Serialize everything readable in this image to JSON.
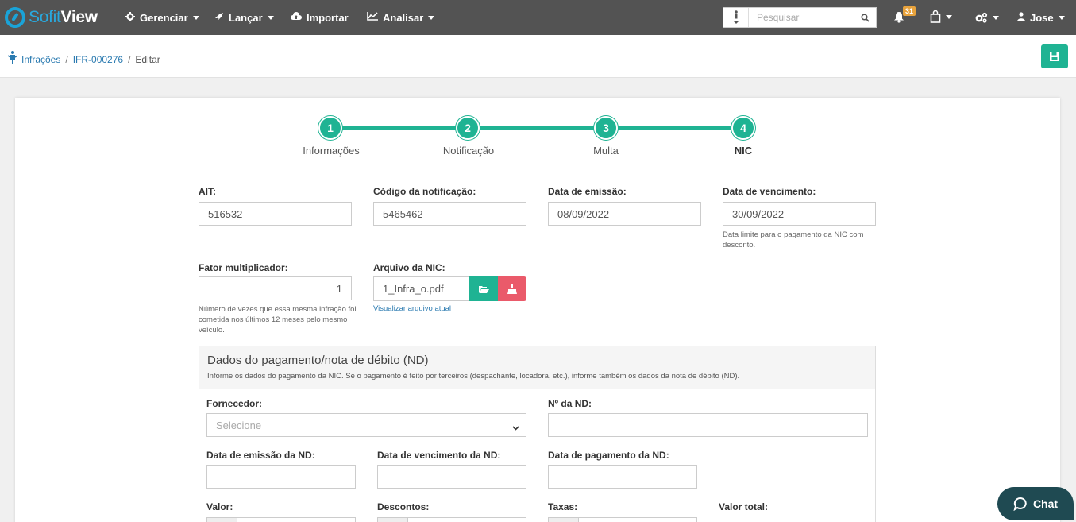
{
  "app": {
    "logo_light": "Sofit",
    "logo_bold": "View"
  },
  "nav": {
    "items": [
      {
        "label": "Gerenciar",
        "icon": "gear-icon"
      },
      {
        "label": "Lançar",
        "icon": "rocket-icon"
      },
      {
        "label": "Importar",
        "icon": "cloud-upload-icon"
      },
      {
        "label": "Analisar",
        "icon": "chart-line-icon"
      }
    ],
    "search_placeholder": "Pesquisar",
    "notifications_count": "31",
    "user": "Jose"
  },
  "breadcrumb": {
    "root": "Infrações",
    "record": "IFR-000276",
    "current": "Editar"
  },
  "steps": [
    {
      "number": "1",
      "label": "Informações"
    },
    {
      "number": "2",
      "label": "Notificação"
    },
    {
      "number": "3",
      "label": "Multa"
    },
    {
      "number": "4",
      "label": "NIC"
    }
  ],
  "form": {
    "ait_label": "AIT:",
    "ait_value": "516532",
    "codigo_label": "Código da notificação:",
    "codigo_value": "5465462",
    "emissao_label": "Data de emissão:",
    "emissao_value": "08/09/2022",
    "vencimento_label": "Data de vencimento:",
    "vencimento_value": "30/09/2022",
    "vencimento_help": "Data limite para o pagamento da NIC com desconto.",
    "fator_label": "Fator multiplicador:",
    "fator_value": "1",
    "fator_help": "Número de vezes que essa mesma infração foi cometida nos últimos 12 meses pelo mesmo veículo.",
    "arquivo_label": "Arquivo da NIC:",
    "arquivo_value": "1_Infra_o.pdf",
    "arquivo_link": "Visualizar arquivo atual"
  },
  "panel": {
    "title": "Dados do pagamento/nota de débito (ND)",
    "subtitle": "Informe os dados do pagamento da NIC. Se o pagamento é feito por terceiros (despachante, locadora, etc.), informe também os dados da nota de débito (ND).",
    "fornecedor_label": "Fornecedor:",
    "fornecedor_placeholder": "Selecione",
    "nd_label": "Nº da ND:",
    "emissao_nd_label": "Data de emissão da ND:",
    "vencimento_nd_label": "Data de vencimento da ND:",
    "pagamento_nd_label": "Data de pagamento da ND:",
    "valor_label": "Valor:",
    "descontos_label": "Descontos:",
    "taxas_label": "Taxas:",
    "valor_total_label": "Valor total:"
  },
  "chat": {
    "label": "Chat"
  }
}
